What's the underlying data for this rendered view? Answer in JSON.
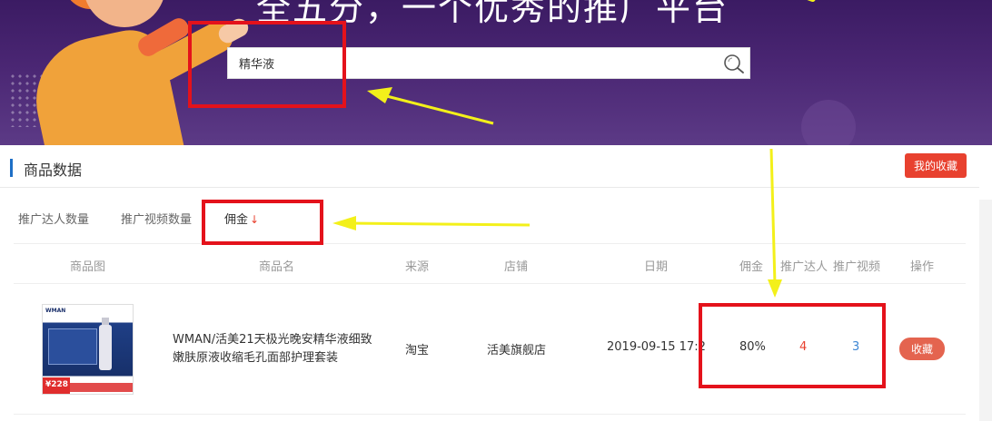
{
  "banner": {
    "title": "全五分，一个优秀的推广平台",
    "search_value": "精华液",
    "search_icon": "search-icon"
  },
  "section": {
    "title": "商品数据",
    "favorites_button": "我的收藏"
  },
  "tabs": [
    {
      "label": "推广达人数量"
    },
    {
      "label": "推广视频数量"
    },
    {
      "label": "佣金",
      "sort_arrow": "↓"
    }
  ],
  "table": {
    "headers": [
      "商品图",
      "商品名",
      "来源",
      "店铺",
      "日期",
      "佣金",
      "推广达人",
      "推广视频",
      "操作"
    ],
    "rows": [
      {
        "image_logo": "WMAN",
        "image_price": "¥228",
        "name": "WMAN/活美21天极光晚安精华液细致嫩肤原液收缩毛孔面部护理套装",
        "source": "淘宝",
        "shop": "活美旗舰店",
        "date": "2019-09-15 17:2",
        "commission": "80%",
        "promoters": "4",
        "videos": "3",
        "action": "收藏"
      }
    ]
  },
  "colors": {
    "banner": "#4a2673",
    "accent_red": "#e8412f",
    "link_blue": "#3d86d4",
    "annotation_red": "#e4121b",
    "annotation_yellow": "#f3f01a"
  }
}
